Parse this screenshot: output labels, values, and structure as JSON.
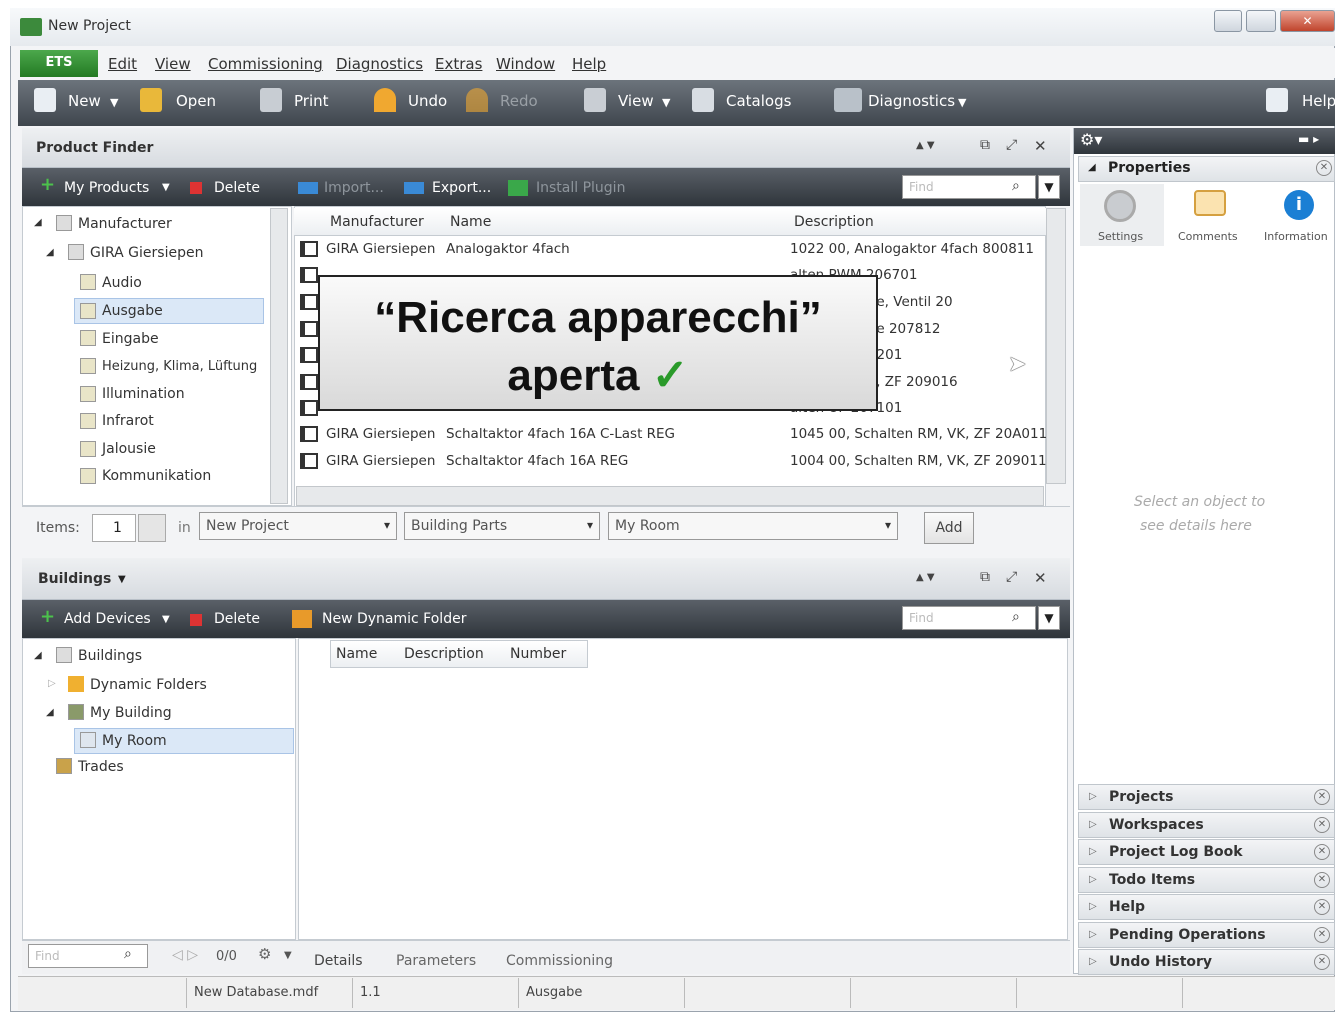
{
  "window": {
    "title": "New Project"
  },
  "menu": {
    "ets": "ETS",
    "items": [
      "Edit",
      "View",
      "Commissioning",
      "Diagnostics",
      "Extras",
      "Window",
      "Help"
    ]
  },
  "toolbar": {
    "new": "New",
    "open": "Open",
    "print": "Print",
    "undo": "Undo",
    "redo": "Redo",
    "view": "View",
    "catalogs": "Catalogs",
    "diagnostics": "Diagnostics",
    "help": "Help"
  },
  "product_finder": {
    "title": "Product Finder",
    "my_products": "My Products",
    "delete": "Delete",
    "import": "Import...",
    "export": "Export...",
    "install_plugin": "Install Plugin",
    "find_placeholder": "Find",
    "tree": [
      "Manufacturer",
      "GIRA Giersiepen",
      "Audio",
      "Ausgabe",
      "Eingabe",
      "Heizung, Klima, Lüftung",
      "Illumination",
      "Infrarot",
      "Jalousie",
      "Kommunikation"
    ],
    "columns": [
      "Manufacturer",
      "Name",
      "Description"
    ],
    "rows": [
      {
        "manufacturer": "GIRA Giersiepen",
        "name": "Analogaktor 4fach",
        "description": "1022 00, Analogaktor 4fach 800811"
      },
      {
        "manufacturer": "",
        "name": "",
        "description": "alten PWM 206701"
      },
      {
        "manufacturer": "",
        "name": "",
        "description": "alten, Jalousie, Ventil 20"
      },
      {
        "manufacturer": "",
        "name": "",
        "description": "alten, Jalousie 207812"
      },
      {
        "manufacturer": "",
        "name": "",
        "description": "alten UP 207201"
      },
      {
        "manufacturer": "",
        "name": "",
        "description": "alten RM, VK, ZF 209016"
      },
      {
        "manufacturer": "",
        "name": "",
        "description": "alten UP 207101"
      },
      {
        "manufacturer": "GIRA Giersiepen",
        "name": "Schaltaktor 4fach 16A C-Last REG",
        "description": "1045 00, Schalten RM, VK, ZF 20A011"
      },
      {
        "manufacturer": "GIRA Giersiepen",
        "name": "Schaltaktor 4fach 16A REG",
        "description": "1004 00, Schalten RM, VK, ZF 209011"
      }
    ],
    "items_label": "Items:",
    "items_value": "1",
    "in_label": "in",
    "combo_project": "New Project",
    "combo_parts": "Building Parts",
    "combo_room": "My Room",
    "add": "Add"
  },
  "buildings": {
    "title": "Buildings",
    "add_devices": "Add Devices",
    "delete": "Delete",
    "new_dynamic_folder": "New Dynamic Folder",
    "find_placeholder": "Find",
    "tree": [
      "Buildings",
      "Dynamic Folders",
      "My Building",
      "My Room",
      "Trades"
    ],
    "columns": [
      "Name",
      "Description",
      "Number"
    ],
    "bottom_find": "Find",
    "pager": "0/0",
    "tabs": [
      "Details",
      "Parameters",
      "Commissioning"
    ]
  },
  "properties": {
    "title": "Properties",
    "tabs": [
      "Settings",
      "Comments",
      "Information"
    ],
    "empty_line1": "Select an object to",
    "empty_line2": "see details here"
  },
  "accordion": [
    "Projects",
    "Workspaces",
    "Project Log Book",
    "Todo Items",
    "Help",
    "Pending Operations",
    "Undo History"
  ],
  "statusbar": {
    "db": "New Database.mdf",
    "addr": "1.1",
    "item": "Ausgabe"
  },
  "callout": {
    "line1": "“Ricerca apparecchi”",
    "line2": "aperta",
    "check": "✓"
  },
  "colors": {
    "ets_green": "#2f8f2f",
    "toolbar_dark": "#4a5158",
    "selection": "#dbe8f7",
    "check_green": "#2a9a2a"
  }
}
